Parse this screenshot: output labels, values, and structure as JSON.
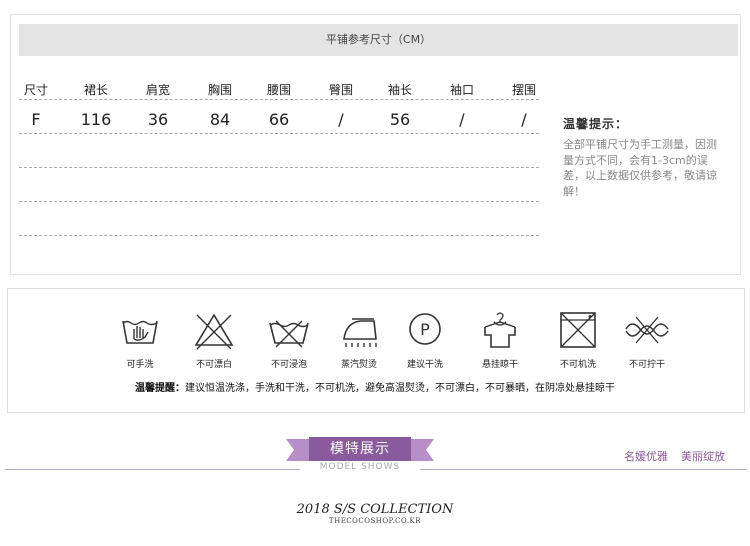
{
  "size_table": {
    "header": "平铺参考尺寸（CM）",
    "columns": [
      "尺寸",
      "裙长",
      "肩宽",
      "胸围",
      "腰围",
      "臀围",
      "袖长",
      "袖口",
      "摆围"
    ],
    "rows": [
      [
        "F",
        "116",
        "36",
        "84",
        "66",
        "/",
        "56",
        "/",
        "/"
      ]
    ]
  },
  "tips": {
    "title": "温馨提示：",
    "body": "全部平铺尺寸为手工测量，因测量方式不同，会有1-3cm的误差，以上数据仅供参考，敬请谅解！"
  },
  "care": {
    "items": [
      {
        "label": "可手洗",
        "icon": "hand-wash-icon"
      },
      {
        "label": "不可漂白",
        "icon": "no-bleach-icon"
      },
      {
        "label": "不可浸泡",
        "icon": "no-soak-icon"
      },
      {
        "label": "蒸汽熨烫",
        "icon": "steam-iron-icon"
      },
      {
        "label": "建议干洗",
        "icon": "dry-clean-icon"
      },
      {
        "label": "悬挂晾干",
        "icon": "hang-dry-icon"
      },
      {
        "label": "不可机洗",
        "icon": "no-machine-wash-icon"
      },
      {
        "label": "不可拧干",
        "icon": "no-wring-icon"
      }
    ],
    "tip_label": "温馨提醒：",
    "tip_text": "建议恒温洗涤，手洗和干洗，不可机洗，避免高温熨烫，不可漂白，不可暴晒，在阴凉处悬挂晾干"
  },
  "banner": {
    "title": "模特展示",
    "subtitle": "MODEL SHOWS",
    "tags": [
      "名媛优雅",
      "美丽绽放"
    ],
    "accent": "#8a5b9c"
  },
  "collection": {
    "title": "2018 S/S COLLECTION",
    "site": "THECOCOSHOP.CO.KR"
  }
}
